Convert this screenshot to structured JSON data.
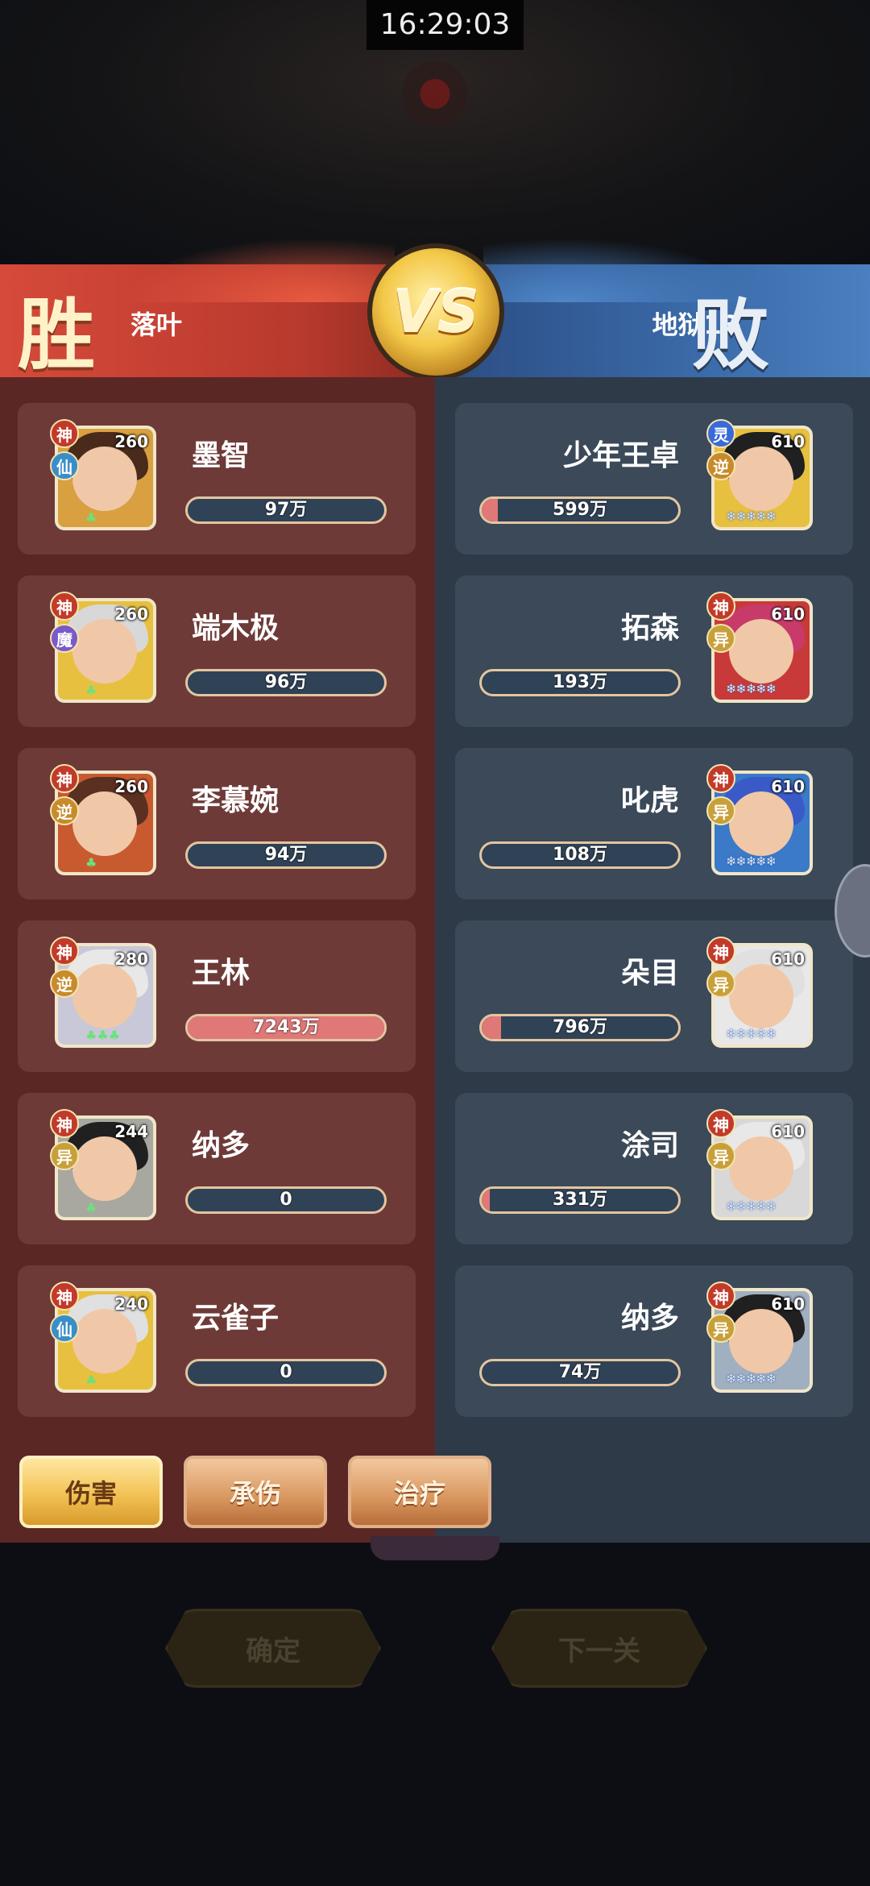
{
  "status_bar": {
    "time": "16:29:03"
  },
  "header": {
    "left_result": "胜",
    "right_result": "败",
    "left_team": "落叶",
    "right_team": "地狱13",
    "vs_label": "VS"
  },
  "left_units": [
    {
      "name": "墨智",
      "level": "260",
      "grade_badge": "神",
      "element_badge": "仙",
      "bar_text": "97万",
      "bar_fill": 0.0
    },
    {
      "name": "端木极",
      "level": "260",
      "grade_badge": "神",
      "element_badge": "魔",
      "bar_text": "96万",
      "bar_fill": 0.0
    },
    {
      "name": "李慕婉",
      "level": "260",
      "grade_badge": "神",
      "element_badge": "逆",
      "bar_text": "94万",
      "bar_fill": 0.0
    },
    {
      "name": "王林",
      "level": "280",
      "grade_badge": "神",
      "element_badge": "逆",
      "bar_text": "7243万",
      "bar_fill": 1.0
    },
    {
      "name": "纳多",
      "level": "244",
      "grade_badge": "神",
      "element_badge": "异",
      "bar_text": "0",
      "bar_fill": 0.0
    },
    {
      "name": "云雀子",
      "level": "240",
      "grade_badge": "神",
      "element_badge": "仙",
      "bar_text": "0",
      "bar_fill": 0.0
    }
  ],
  "right_units": [
    {
      "name": "少年王卓",
      "level": "610",
      "grade_badge": "灵",
      "element_badge": "逆",
      "bar_text": "599万",
      "bar_fill": 0.08
    },
    {
      "name": "拓森",
      "level": "610",
      "grade_badge": "神",
      "element_badge": "异",
      "bar_text": "193万",
      "bar_fill": 0.0
    },
    {
      "name": "叱虎",
      "level": "610",
      "grade_badge": "神",
      "element_badge": "异",
      "bar_text": "108万",
      "bar_fill": 0.0
    },
    {
      "name": "朵目",
      "level": "610",
      "grade_badge": "神",
      "element_badge": "异",
      "bar_text": "796万",
      "bar_fill": 0.1
    },
    {
      "name": "涂司",
      "level": "610",
      "grade_badge": "神",
      "element_badge": "异",
      "bar_text": "331万",
      "bar_fill": 0.04
    },
    {
      "name": "纳多",
      "level": "610",
      "grade_badge": "神",
      "element_badge": "异",
      "bar_text": "74万",
      "bar_fill": 0.0
    }
  ],
  "tabs": [
    {
      "label": "伤害",
      "active": true
    },
    {
      "label": "承伤",
      "active": false
    },
    {
      "label": "治疗",
      "active": false
    }
  ],
  "bottom_buttons": {
    "confirm": "确定",
    "next": "下一关"
  },
  "colors": {
    "win_red": "#d64a3a",
    "lose_blue": "#3a6aa8",
    "bar_fill": "#e07878",
    "tab_gold": "#f2c254"
  }
}
